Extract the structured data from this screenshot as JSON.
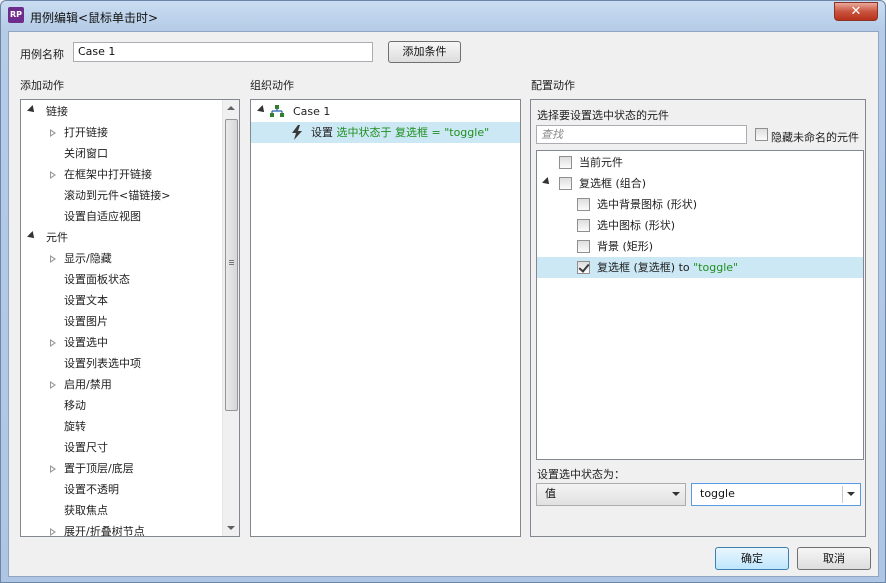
{
  "window": {
    "title": "用例编辑<鼠标单击时>",
    "app_icon_text": "RP"
  },
  "case_name": {
    "label": "用例名称",
    "value": "Case 1"
  },
  "add_condition_label": "添加条件",
  "add_actions": {
    "header": "添加动作",
    "groups": [
      {
        "label": "链接",
        "items": [
          {
            "label": "打开链接",
            "expandable": true
          },
          {
            "label": "关闭窗口",
            "expandable": false
          },
          {
            "label": "在框架中打开链接",
            "expandable": true
          },
          {
            "label": "滚动到元件<锚链接>",
            "expandable": false
          },
          {
            "label": "设置自适应视图",
            "expandable": false
          }
        ]
      },
      {
        "label": "元件",
        "items": [
          {
            "label": "显示/隐藏",
            "expandable": true
          },
          {
            "label": "设置面板状态",
            "expandable": false
          },
          {
            "label": "设置文本",
            "expandable": false
          },
          {
            "label": "设置图片",
            "expandable": false
          },
          {
            "label": "设置选中",
            "expandable": true
          },
          {
            "label": "设置列表选中项",
            "expandable": false
          },
          {
            "label": "启用/禁用",
            "expandable": true
          },
          {
            "label": "移动",
            "expandable": false
          },
          {
            "label": "旋转",
            "expandable": false
          },
          {
            "label": "设置尺寸",
            "expandable": false
          },
          {
            "label": "置于顶层/底层",
            "expandable": true
          },
          {
            "label": "设置不透明",
            "expandable": false
          },
          {
            "label": "获取焦点",
            "expandable": false
          },
          {
            "label": "展开/折叠树节点",
            "expandable": true
          }
        ]
      }
    ]
  },
  "organize_actions": {
    "header": "组织动作",
    "case_label": "Case 1",
    "action": {
      "prefix": "设置 ",
      "highlight": "选中状态于 复选框 = \"toggle\""
    }
  },
  "configure_actions": {
    "header": "配置动作",
    "select_label": "选择要设置选中状态的元件",
    "search_placeholder": "查找",
    "hide_unnamed_label": "隐藏未命名的元件",
    "tree": {
      "current": "当前元件",
      "group": "复选框 (组合)",
      "children": [
        {
          "label": "选中背景图标 (形状)",
          "checked": false
        },
        {
          "label": "选中图标 (形状)",
          "checked": false
        },
        {
          "label": "背景 (矩形)",
          "checked": false
        },
        {
          "label": "复选框 (复选框) to ",
          "value": "\"toggle\"",
          "checked": true
        }
      ]
    },
    "set_state_label": "设置选中状态为：",
    "mode_value": "值",
    "state_value": "toggle"
  },
  "buttons": {
    "ok": "确定",
    "cancel": "取消"
  },
  "colors": {
    "selection": "#cce8f4",
    "value_green": "#1f8f1f",
    "title_bg": "#c9dcf1",
    "close_red": "#c8543f"
  }
}
